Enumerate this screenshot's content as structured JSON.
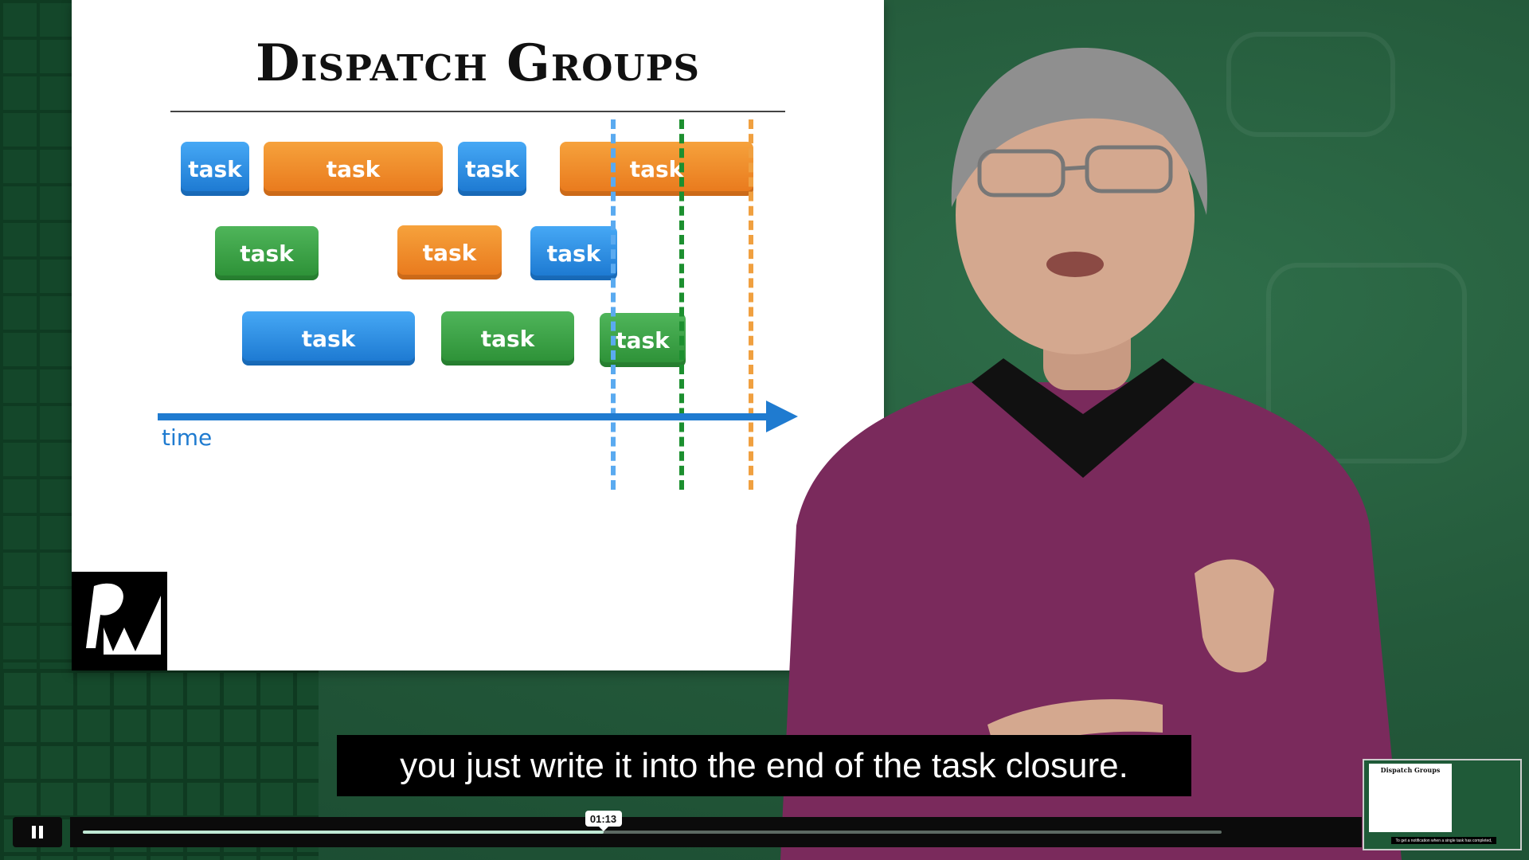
{
  "slide": {
    "title": "Dispatch Groups",
    "axis_label": "time",
    "task_label": "task"
  },
  "caption": "you just write it into the end of the task closure.",
  "player": {
    "time_tooltip": "01:13",
    "progress": 0.457
  },
  "thumbnail": {
    "title": "Dispatch Groups",
    "caption": "To get a notification when a single task has completed,"
  },
  "colors": {
    "blue": "#1a76cf",
    "orange": "#e8771b",
    "green": "#2b8f35",
    "dashed_blue": "#5aaaf0",
    "dashed_green": "#1c8f2f",
    "dashed_orange": "#f0a040"
  }
}
